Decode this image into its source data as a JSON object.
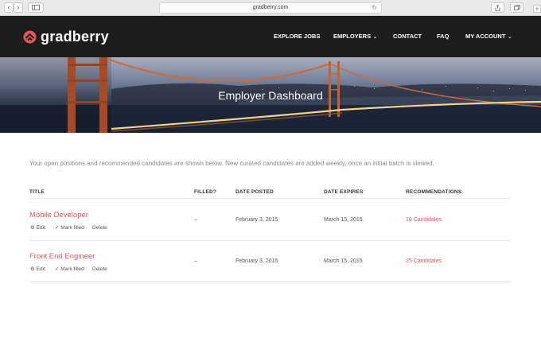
{
  "browser": {
    "url": "gradberry.com"
  },
  "brand": {
    "name": "gradberry",
    "accent": "#e2575d"
  },
  "nav": {
    "explore": "EXPLORE JOBS",
    "employers": "EMPLOYERS",
    "contact": "CONTACT",
    "faq": "FAQ",
    "account": "MY ACCOUNT",
    "caret": "⌄"
  },
  "hero": {
    "title": "Employer Dashboard"
  },
  "intro": "Your open positions and recommended candidates are shown below. New curated candidates are added weekly, once an initial batch is viewed.",
  "table": {
    "headers": {
      "title": "TITLE",
      "filled": "FILLED?",
      "posted": "DATE POSTED",
      "expires": "DATE EXPIRES",
      "recs": "RECOMMENDATIONS"
    },
    "actions": {
      "edit": "Edit",
      "mark": "Mark filled",
      "delete": "Delete"
    },
    "rows": [
      {
        "title": "Mobile Developer",
        "filled": "–",
        "posted": "February 3, 2015",
        "expires": "March 15, 2015",
        "recs": "18 Candidates"
      },
      {
        "title": "Front End Engineer",
        "filled": "–",
        "posted": "February 3, 2015",
        "expires": "March 15, 2015",
        "recs": "25 Candidates"
      }
    ]
  }
}
